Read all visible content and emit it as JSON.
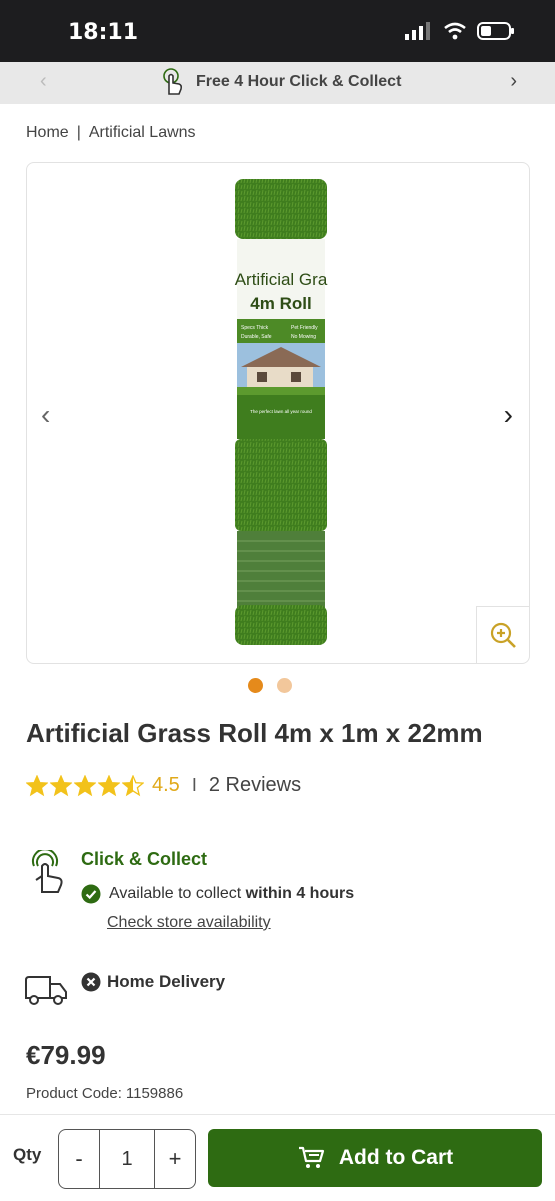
{
  "status": {
    "time": "18:11"
  },
  "promo": {
    "text": "Free 4 Hour Click & Collect"
  },
  "breadcrumb": {
    "items": [
      "Home",
      "Artificial Lawns"
    ]
  },
  "product_image": {
    "label_line1": "Artificial Gra",
    "label_line2": "4m Roll",
    "spec_left": "Specs Thick",
    "spec_right": "Pet Friendly",
    "spec_left2": "Durable, Safe",
    "spec_right2": "No Mowing",
    "tagline": "The perfect lawn all year round"
  },
  "product": {
    "title": "Artificial Grass Roll 4m x 1m x 22mm",
    "rating": "4.5",
    "rating_stars": 4.5,
    "reviews": "2 Reviews",
    "price": "€79.99",
    "code_label": "Product Code:",
    "code_value": "1159886"
  },
  "click_collect": {
    "title": "Click & Collect",
    "available_prefix": "Available to collect ",
    "available_bold": "within 4 hours",
    "check_link": "Check store availability"
  },
  "home_delivery": {
    "label": "Home Delivery"
  },
  "cart": {
    "qty_label": "Qty",
    "qty_minus": "-",
    "qty_value": "1",
    "qty_plus": "+",
    "add_label": "Add to Cart"
  },
  "colors": {
    "brand_green": "#2e6b12",
    "star": "#f2c21b",
    "dot_active": "#e58a1b"
  },
  "icons": [
    "hand-tap-icon",
    "chevron-left-icon",
    "chevron-right-icon",
    "zoom-in-icon",
    "star-icon",
    "check-circle-icon",
    "van-icon",
    "cross-circle-icon",
    "cart-icon"
  ]
}
